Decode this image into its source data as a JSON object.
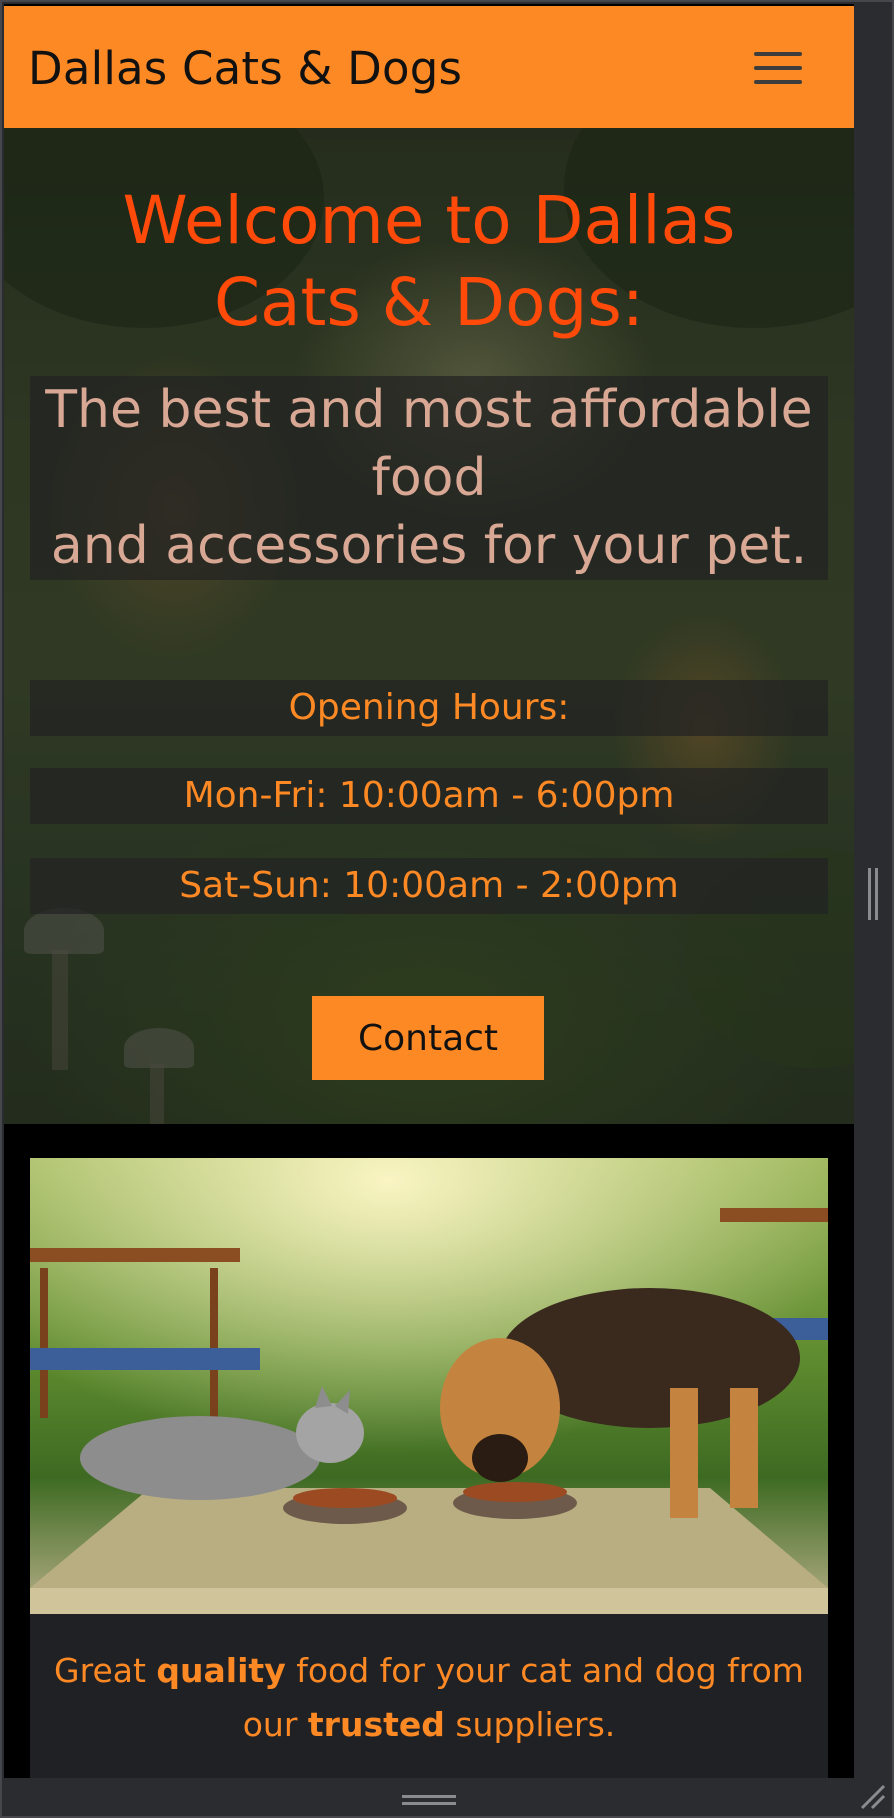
{
  "navbar": {
    "brand": "Dallas Cats & Dogs",
    "menu_icon": "hamburger-menu-icon",
    "background_color": "#fd8924"
  },
  "hero": {
    "title": "Welcome to Dallas Cats & Dogs:",
    "tagline_line1": "The best and most affordable food",
    "tagline_line2": "and accessories for your pet.",
    "hours_heading": "Opening Hours:",
    "hours_weekday": "Mon-Fri: 10:00am - 6:00pm",
    "hours_weekend": "Sat-Sun: 10:00am - 2:00pm",
    "contact_label": "Contact",
    "title_color": "#ff4a0a",
    "accent_color": "#fd8924"
  },
  "feature_card": {
    "caption_part1": "Great ",
    "caption_bold1": "quality",
    "caption_part2": " food for your cat and dog from our ",
    "caption_bold2": "trusted",
    "caption_part3": " suppliers."
  }
}
